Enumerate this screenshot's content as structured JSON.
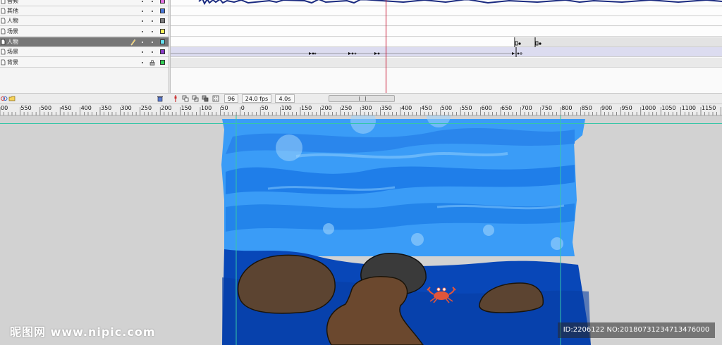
{
  "layers": [
    {
      "name": "音频",
      "color": "#e070e0",
      "selected": false
    },
    {
      "name": "其他",
      "color": "#4a78d8",
      "selected": false
    },
    {
      "name": "人物",
      "color": "#808080",
      "selected": false
    },
    {
      "name": "场景",
      "color": "#f5ee58",
      "selected": false
    },
    {
      "name": "人物",
      "color": "#66e0ee",
      "selected": true
    },
    {
      "name": "场景",
      "color": "#8a3cc8",
      "selected": false
    },
    {
      "name": "背景",
      "color": "#33cc55",
      "selected": false
    }
  ],
  "toolbar": {
    "frame": "96",
    "fps": "24.0 fps",
    "time": "4.0s"
  },
  "ruler": {
    "labels": [
      "00",
      "550",
      "500",
      "450",
      "400",
      "350",
      "300",
      "250",
      "200",
      "150",
      "100",
      "50",
      "0",
      "50",
      "100",
      "150",
      "200",
      "250",
      "300",
      "350",
      "400",
      "450",
      "500",
      "550",
      "600",
      "650",
      "700",
      "750",
      "800",
      "850",
      "900",
      "950",
      "1000",
      "1050",
      "1100",
      "1150"
    ]
  },
  "watermark": {
    "logo": "昵图网 www.nipic.com",
    "id": "ID:2206122 NO:20180731234713476000"
  },
  "colors": {
    "sky_light": "#3a9cf7",
    "water_mid": "#0a79ee",
    "sea_deep": "#0847b8",
    "rock_brown": "#5c4431",
    "rock_dark": "#3a3a3a",
    "crab": "#e2553a"
  }
}
